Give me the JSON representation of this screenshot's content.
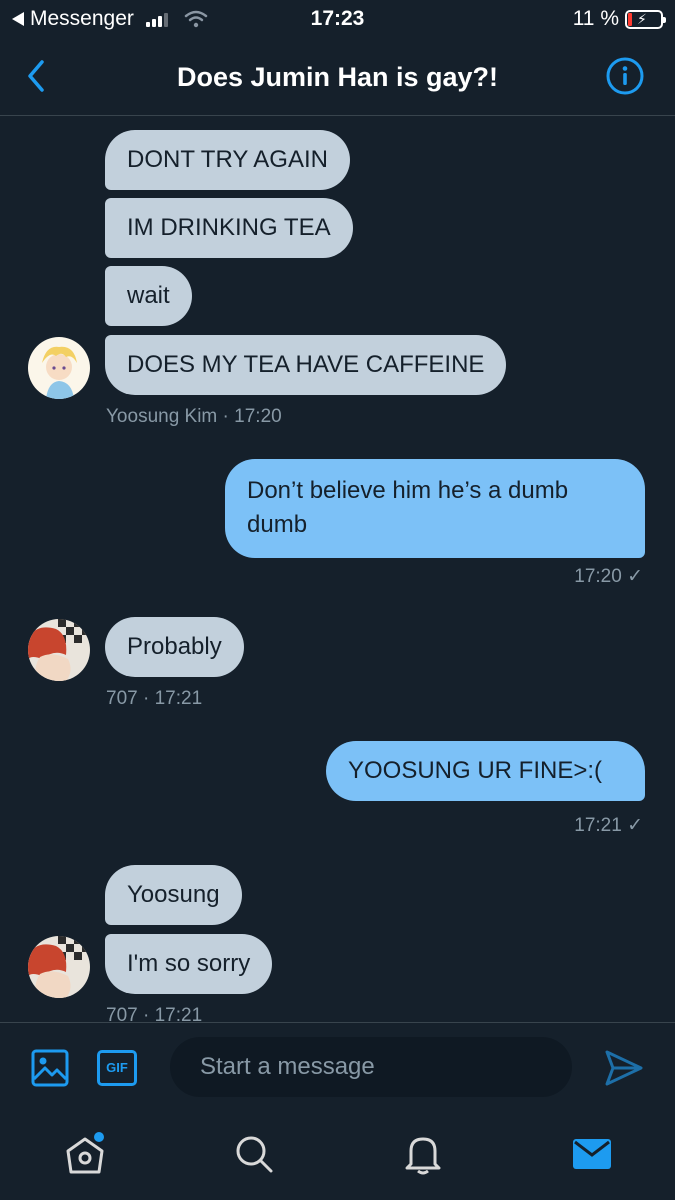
{
  "status_bar": {
    "back_app": "Messenger",
    "time": "17:23",
    "battery_percent": "11 %",
    "battery_level": 0.11
  },
  "header": {
    "title": "Does Jumin Han is gay?!",
    "back_icon": "chevron-left-icon",
    "info_icon": "info-icon"
  },
  "messages": [
    {
      "direction": "in",
      "text": "DONT TRY AGAIN"
    },
    {
      "direction": "in",
      "text": "IM DRINKING TEA"
    },
    {
      "direction": "in",
      "text": "wait"
    },
    {
      "direction": "in",
      "text": "DOES MY TEA HAVE CAFFEINE"
    },
    {
      "direction": "in_meta",
      "sender": "Yoosung Kim",
      "time": "· 17:20"
    },
    {
      "direction": "out",
      "text": "Don’t believe him he’s a dumb dumb"
    },
    {
      "direction": "out_meta",
      "time": "17:20 ✓"
    },
    {
      "direction": "in",
      "text": "Probably"
    },
    {
      "direction": "in_meta",
      "sender": "707",
      "time": "· 17:21"
    },
    {
      "direction": "out",
      "text": "YOOSUNG UR FINE>:("
    },
    {
      "direction": "out_meta",
      "time": "17:21 ✓"
    },
    {
      "direction": "in",
      "text": "Yoosung"
    },
    {
      "direction": "in",
      "text": "I'm so sorry"
    },
    {
      "direction": "in_meta",
      "sender": "707",
      "time": "· 17:21"
    }
  ],
  "composer": {
    "placeholder": "Start a message",
    "gif_label": "GIF",
    "media_icon": "image-icon",
    "send_icon": "send-icon"
  },
  "tab_bar": {
    "items": [
      "home-icon",
      "search-icon",
      "bell-icon",
      "mail-icon"
    ],
    "active": "mail-icon",
    "home_has_badge": true
  },
  "colors": {
    "background": "#15202b",
    "incoming_bubble": "#c2d0dc",
    "outgoing_bubble": "#7cc1f7",
    "accent": "#1d9bf0",
    "muted_text": "#8899a6"
  }
}
